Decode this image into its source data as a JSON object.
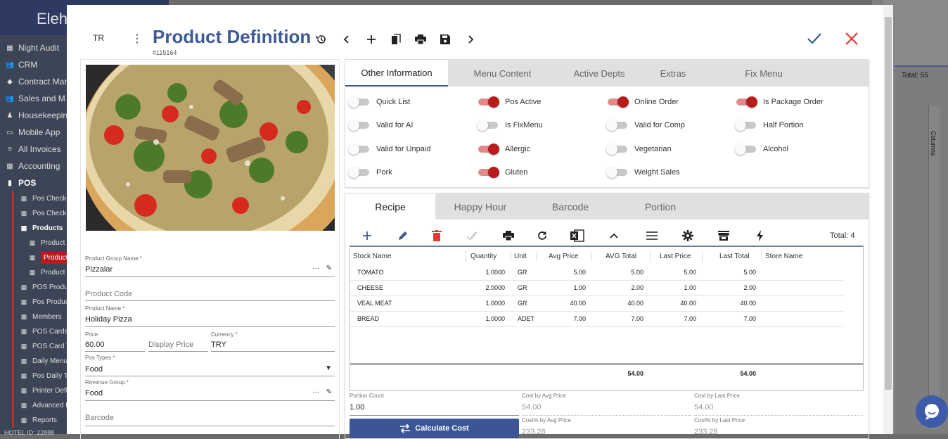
{
  "background": {
    "app_title": "Eleh",
    "nav": [
      {
        "label": "Night Audit",
        "icon": "calendar-icon"
      },
      {
        "label": "CRM",
        "icon": "people-icon"
      },
      {
        "label": "Contract Mar",
        "icon": "tag-icon"
      },
      {
        "label": "Sales and M",
        "icon": "group-icon"
      },
      {
        "label": "Housekeepin",
        "icon": "person-icon"
      },
      {
        "label": "Mobile App",
        "icon": "devices-icon"
      },
      {
        "label": "All Invoices",
        "icon": "list-icon"
      },
      {
        "label": "Accounting",
        "icon": "grid-icon"
      },
      {
        "label": "POS",
        "icon": "pos-icon"
      }
    ],
    "pos_sub": [
      {
        "label": "Pos Check",
        "level": 1
      },
      {
        "label": "Pos Check",
        "level": 1
      },
      {
        "label": "Products",
        "level": 1
      },
      {
        "label": "Product",
        "level": 2
      },
      {
        "label": "Product",
        "level": 2
      },
      {
        "label": "Product",
        "level": 2
      },
      {
        "label": "POS Produc",
        "level": 1
      },
      {
        "label": "Pos Produc",
        "level": 1
      },
      {
        "label": "Members",
        "level": 1
      },
      {
        "label": "POS Cards",
        "level": 1
      },
      {
        "label": "POS Card T",
        "level": 1
      },
      {
        "label": "Daily Menus",
        "level": 1
      },
      {
        "label": "Pos Daily Te",
        "level": 1
      },
      {
        "label": "Printer Defi",
        "level": 1
      },
      {
        "label": "Advanced F",
        "level": 1
      },
      {
        "label": "Reports",
        "level": 1
      }
    ],
    "hotel_id": "HOTEL ID: 22888",
    "right_total": "Total: 55",
    "columns_label": "Columns"
  },
  "header": {
    "lang": "TR",
    "title": "Product Definition",
    "id": "#115164"
  },
  "form": {
    "group_name_label": "Product Group Name *",
    "group_name_value": "Pizzalar",
    "code_placeholder": "Product Code",
    "name_label": "Product Name *",
    "name_value": "Holiday Pizza",
    "price_label": "Price",
    "price_value": "60.00",
    "display_price_placeholder": "Display Price",
    "currency_label": "Currency *",
    "currency_value": "TRY",
    "pos_types_label": "Pos Types *",
    "pos_types_value": "Food",
    "revenue_group_label": "Revenue Group *",
    "revenue_group_value": "Food",
    "barcode_placeholder": "Barcode",
    "ellipsis": "···"
  },
  "info_tabs": [
    "Other Information",
    "Menu Content",
    "Active Depts",
    "Extras",
    "Fix Menu"
  ],
  "toggles": [
    [
      {
        "label": "Quick List",
        "on": false
      },
      {
        "label": "Pos Active",
        "on": true
      },
      {
        "label": "Online Order",
        "on": true
      },
      {
        "label": "Is Package Order",
        "on": true
      }
    ],
    [
      {
        "label": "Valid for AI",
        "on": false
      },
      {
        "label": "Is FixMenu",
        "on": false
      },
      {
        "label": "Valid for Comp",
        "on": false
      },
      {
        "label": "Half Portion",
        "on": false
      }
    ],
    [
      {
        "label": "Valid for Unpaid",
        "on": false
      },
      {
        "label": "Allergic",
        "on": true
      },
      {
        "label": "Vegetarian",
        "on": false
      },
      {
        "label": "Alcohol",
        "on": false
      }
    ],
    [
      {
        "label": "Pork",
        "on": false
      },
      {
        "label": "Gluten",
        "on": true
      },
      {
        "label": "Weight Sales",
        "on": false
      }
    ]
  ],
  "recipe_tabs": [
    "Recipe",
    "Happy Hour",
    "Barcode",
    "Portion"
  ],
  "recipe_total": "Total: 4",
  "colors": {
    "accent": "#3d5a96",
    "toggle_on": "#b71c1c",
    "delete": "#e53935"
  },
  "grid": {
    "headers": [
      "Stock Name",
      "Quantity",
      "Unit",
      "Avg Price",
      "AVG Total",
      "Last Price",
      "Last Total",
      "Store Name"
    ],
    "rows": [
      [
        "TOMATO",
        "1.0000",
        "GR",
        "5.00",
        "5.00",
        "5.00",
        "5.00",
        ""
      ],
      [
        "CHEESE",
        "2.0000",
        "GR",
        "1.00",
        "2.00",
        "1.00",
        "2.00",
        ""
      ],
      [
        "VEAL MEAT",
        "1.0000",
        "GR",
        "40.00",
        "40.00",
        "40.00",
        "40.00",
        ""
      ],
      [
        "BREAD",
        "1.0000",
        "ADET",
        "7.00",
        "7.00",
        "7.00",
        "7.00",
        ""
      ]
    ],
    "avg_total_sum": "54.00",
    "last_total_sum": "54.00"
  },
  "cost": {
    "portion_label": "Portion Count",
    "portion_value": "1.00",
    "cost_avg_label": "Cost by Avg Price",
    "cost_avg_value": "54.00",
    "cost_last_label": "Cost by Last Price",
    "cost_last_value": "54.00",
    "costpct_avg_label": "Cost% by Avg Price",
    "costpct_avg_value": "233.28",
    "costpct_last_label": "Cost% by Last Price",
    "costpct_last_value": "233.28",
    "calc_label": "Calculate Cost"
  }
}
